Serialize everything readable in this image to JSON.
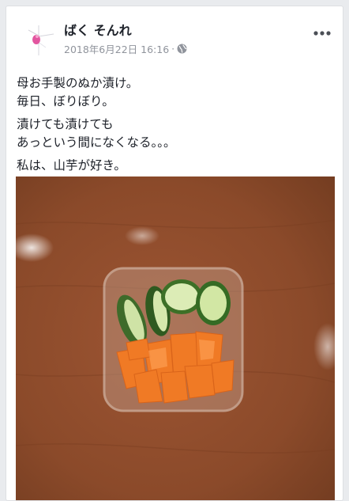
{
  "post": {
    "author": "ばく そんれ",
    "timestamp": "2018年6月22日 16:16",
    "separator": "·",
    "privacy_icon": "globe-icon",
    "more_icon": "more-options-icon",
    "paragraphs": [
      [
        "母お手製のぬか漬け。",
        "毎日、ぼりぼり。"
      ],
      [
        "漬けても漬けても",
        "あっという間になくなる。。。"
      ],
      [
        "私は、山芋が好き。"
      ]
    ],
    "photo_subject": "pickled-vegetables-photo"
  },
  "colors": {
    "background": "#e9ebee",
    "card": "#ffffff",
    "meta_text": "#90949c",
    "body_text": "#1d2129",
    "table_wood": "#8b4a2a"
  }
}
